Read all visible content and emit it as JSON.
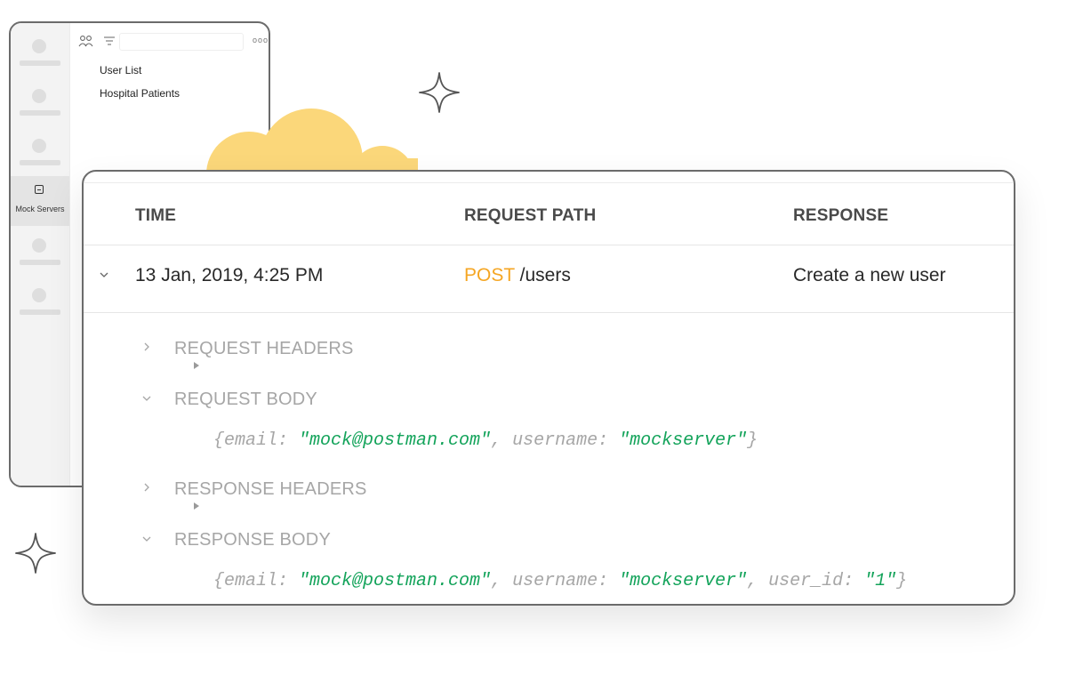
{
  "sidebar": {
    "active_item_label": "Mock Servers",
    "collections": [
      "User List",
      "Hospital Patients"
    ],
    "more_label": "ooo"
  },
  "table": {
    "columns": [
      "TIME",
      "REQUEST PATH",
      "RESPONSE"
    ],
    "row": {
      "time": "13 Jan, 2019, 4:25 PM",
      "method": "POST",
      "path": "/users",
      "response": "Create a new user"
    }
  },
  "details": {
    "request_headers_label": "REQUEST HEADERS",
    "request_body_label": "REQUEST BODY",
    "response_headers_label": "RESPONSE HEADERS",
    "response_body_label": "RESPONSE BODY",
    "request_body": {
      "open": "{email: ",
      "email": "\"mock@postman.com\"",
      "sep1": ", username: ",
      "username": "\"mockserver\"",
      "close": "}"
    },
    "response_body": {
      "open": "{email: ",
      "email": "\"mock@postman.com\"",
      "sep1": ", username: ",
      "username": "\"mockserver\"",
      "sep2": ", user_id: ",
      "user_id": "\"1\"",
      "close": "}"
    }
  },
  "colors": {
    "method_post": "#f5a623",
    "string_value": "#13a35a",
    "muted_text": "#a6a6a6",
    "cloud": "#fbd77a"
  }
}
